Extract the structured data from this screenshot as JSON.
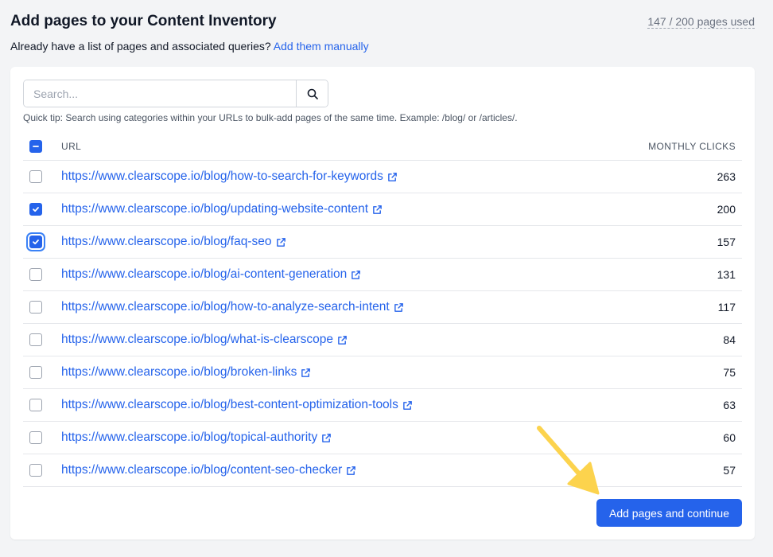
{
  "header": {
    "title": "Add pages to your Content Inventory",
    "usage": "147 / 200 pages used",
    "subtitle_text": "Already have a list of pages and associated queries?",
    "subtitle_link": "Add them manually"
  },
  "search": {
    "placeholder": "Search...",
    "value": "",
    "button_icon": "search-icon"
  },
  "tip": "Quick tip: Search using categories within your URLs to bulk-add pages of the same time. Example: /blog/ or /articles/.",
  "table": {
    "select_all_state": "indeterminate",
    "columns": {
      "url": "URL",
      "clicks": "MONTHLY CLICKS"
    },
    "rows": [
      {
        "url": "https://www.clearscope.io/blog/how-to-search-for-keywords",
        "clicks": "263",
        "checked": false
      },
      {
        "url": "https://www.clearscope.io/blog/updating-website-content",
        "clicks": "200",
        "checked": true
      },
      {
        "url": "https://www.clearscope.io/blog/faq-seo",
        "clicks": "157",
        "checked": true
      },
      {
        "url": "https://www.clearscope.io/blog/ai-content-generation",
        "clicks": "131",
        "checked": false
      },
      {
        "url": "https://www.clearscope.io/blog/how-to-analyze-search-intent",
        "clicks": "117",
        "checked": false
      },
      {
        "url": "https://www.clearscope.io/blog/what-is-clearscope",
        "clicks": "84",
        "checked": false
      },
      {
        "url": "https://www.clearscope.io/blog/broken-links",
        "clicks": "75",
        "checked": false
      },
      {
        "url": "https://www.clearscope.io/blog/best-content-optimization-tools",
        "clicks": "63",
        "checked": false
      },
      {
        "url": "https://www.clearscope.io/blog/topical-authority",
        "clicks": "60",
        "checked": false
      },
      {
        "url": "https://www.clearscope.io/blog/content-seo-checker",
        "clicks": "57",
        "checked": false
      }
    ]
  },
  "actions": {
    "continue_label": "Add pages and continue"
  },
  "colors": {
    "accent": "#2563eb",
    "annotation_arrow": "#fcd34d"
  }
}
